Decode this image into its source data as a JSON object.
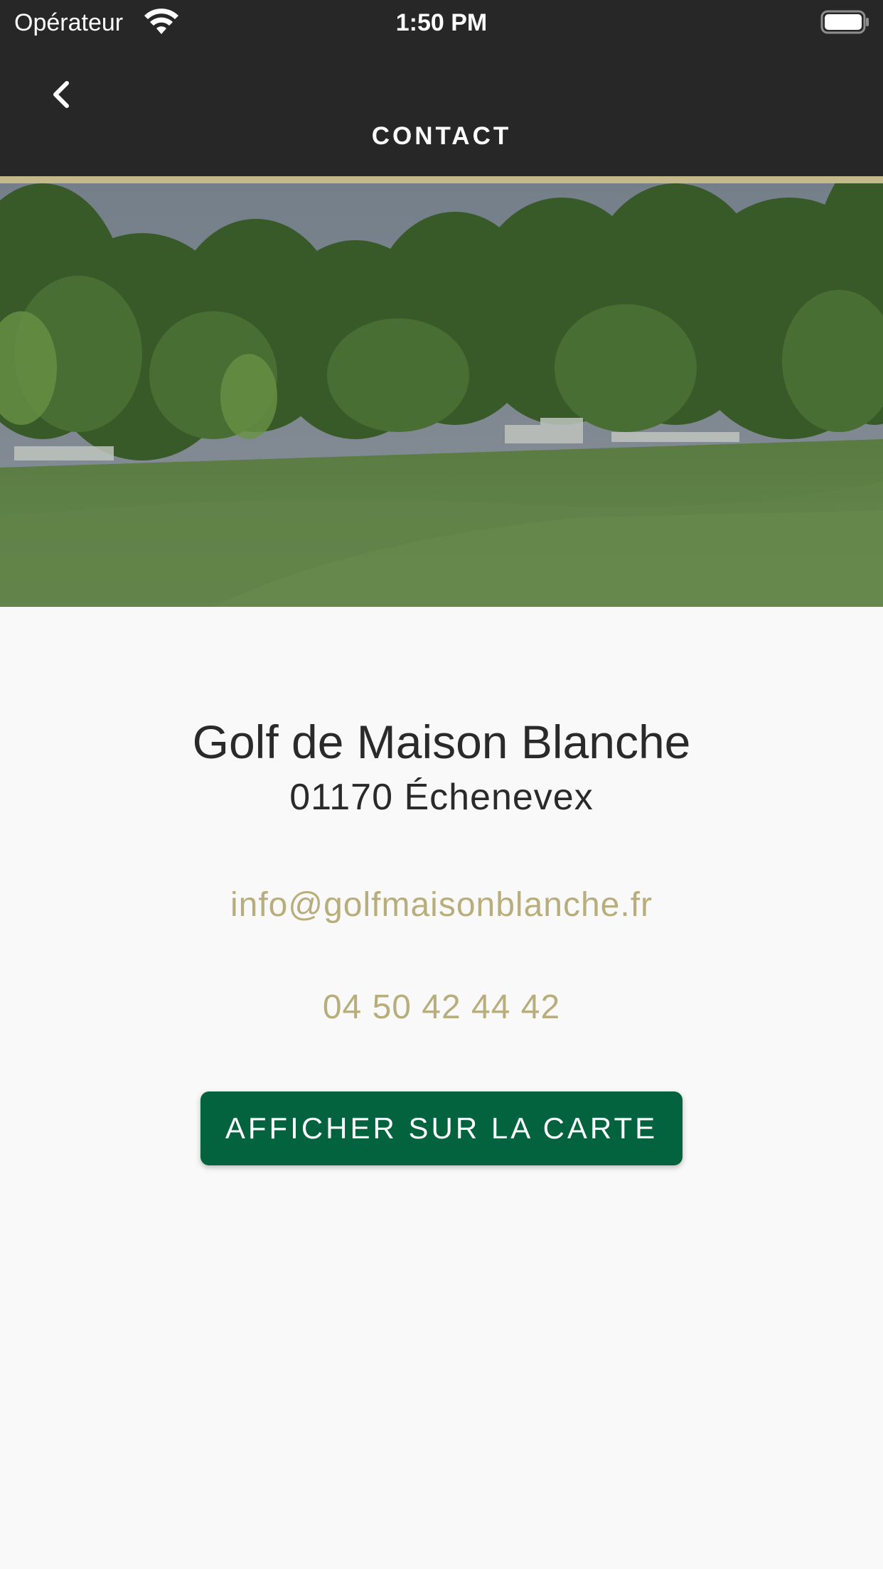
{
  "status_bar": {
    "carrier": "Opérateur",
    "time": "1:50 PM",
    "wifi_icon": "wifi-icon",
    "battery_icon": "battery-icon"
  },
  "nav": {
    "title": "CONTACT",
    "back_icon": "chevron-left-icon"
  },
  "hero": {
    "image": "golf-course-photo"
  },
  "contact": {
    "name": "Golf de Maison Blanche",
    "address": "01170 Échenevex",
    "email": "info@golfmaisonblanche.fr",
    "phone": "04 50 42 44 42",
    "map_button_label": "AFFICHER SUR LA CARTE"
  },
  "colors": {
    "header_bg": "#272727",
    "accent_gold": "#c3b98a",
    "link_gold": "#b8ad7c",
    "button_green": "#03633f",
    "page_bg": "#f9f9f9",
    "text_dark": "#2a2a2a"
  }
}
